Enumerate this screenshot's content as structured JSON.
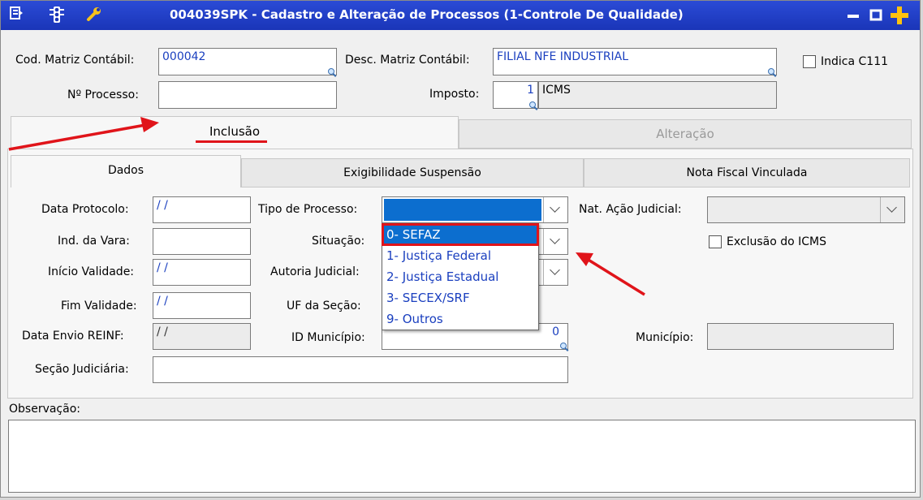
{
  "window": {
    "title": "004039SPK - Cadastro e Alteração de Processos (1-Controle De Qualidade)"
  },
  "header": {
    "cod_matriz_label": "Cod. Matriz Contábil:",
    "cod_matriz_value": "000042",
    "desc_matriz_label": "Desc. Matriz Contábil:",
    "desc_matriz_value": "FILIAL NFE INDUSTRIAL",
    "indica_c111_label": "Indica C111",
    "num_processo_label": "Nº Processo:",
    "num_processo_value": "",
    "imposto_label": "Imposto:",
    "imposto_code": "1",
    "imposto_name": "ICMS"
  },
  "top_tabs": [
    "Inclusão",
    "Alteração"
  ],
  "sub_tabs": [
    "Dados",
    "Exigibilidade Suspensão",
    "Nota Fiscal Vinculada"
  ],
  "form": {
    "data_protocolo_label": "Data Protocolo:",
    "data_protocolo_value": " / /",
    "ind_vara_label": "Ind. da Vara:",
    "inicio_validade_label": "Início Validade:",
    "inicio_validade_value": " / /",
    "fim_validade_label": "Fim Validade:",
    "fim_validade_value": " / /",
    "data_envio_label": "Data Envio REINF:",
    "data_envio_value": " / /",
    "secao_judiciaria_label": "Seção Judiciária:",
    "tipo_processo_label": "Tipo de Processo:",
    "situacao_label": "Situação:",
    "autoria_label": "Autoria Judicial:",
    "uf_secao_label": "UF da Seção:",
    "id_municipio_label": "ID Município:",
    "id_municipio_value": "0",
    "nat_acao_label": "Nat. Ação Judicial:",
    "exclusao_icms_label": "Exclusão do ICMS",
    "municipio_label": "Município:",
    "observacao_label": "Observação:"
  },
  "dropdown": {
    "items": [
      "0- SEFAZ",
      "1- Justiça Federal",
      "2- Justiça Estadual",
      "3- SECEX/SRF",
      "9- Outros"
    ],
    "selected_index": 0
  },
  "colors": {
    "title_bar": "#1f3fc8",
    "accent_red": "#e0141a",
    "selection": "#0c6ecf",
    "value_text": "#1a3fbf"
  }
}
